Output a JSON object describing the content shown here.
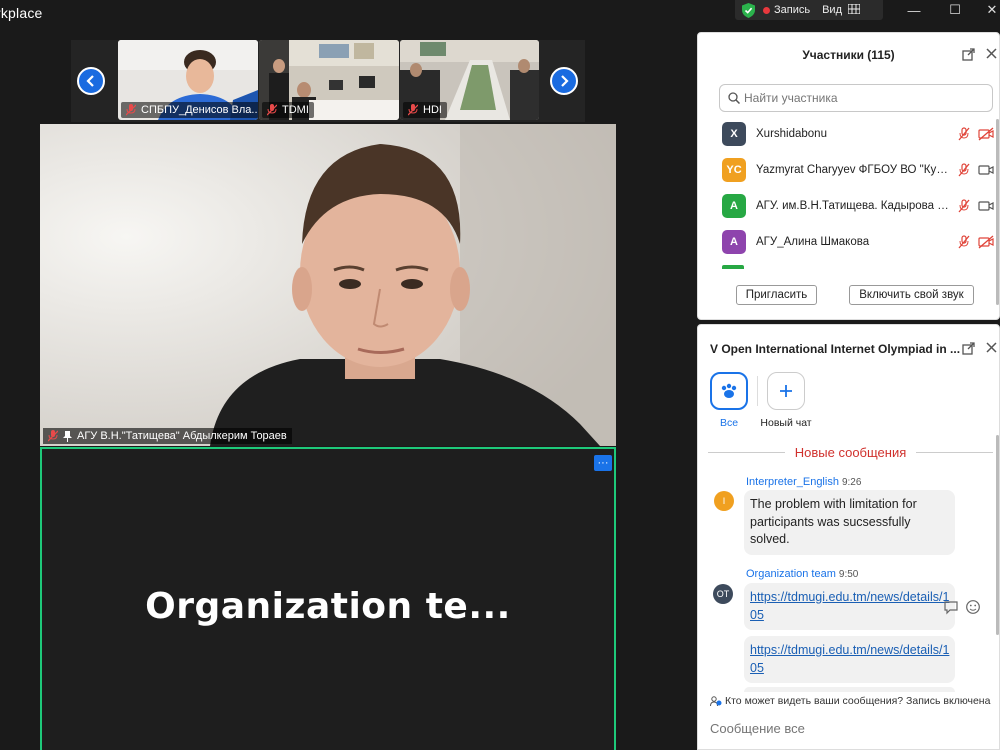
{
  "window": {
    "title": "rkplace",
    "recording_label": "Запись",
    "view_label": "Вид",
    "minimize": "—",
    "maximize": "☐",
    "close": "✕"
  },
  "filmstrip": {
    "tiles": [
      {
        "label": "СПБПУ_Денисов Вла..."
      },
      {
        "label": "TDMI"
      },
      {
        "label": "HDI"
      }
    ]
  },
  "main_video": {
    "label": "АГУ В.Н.\"Татищева\" Абдылкерим Тораев"
  },
  "active_tile": {
    "name": "Organization  te...",
    "menu": "···"
  },
  "participants": {
    "title": "Участники (115)",
    "search_placeholder": "Найти участника",
    "items": [
      {
        "initials": "X",
        "color": "#3d4a5c",
        "name": "Xurshidabonu",
        "video_muted": true
      },
      {
        "initials": "YC",
        "color": "#f0a020",
        "name": "Yazmyrat Charyyev ФГБОУ ВО \"КубГ...",
        "video_muted": false
      },
      {
        "initials": "A",
        "color": "#27a844",
        "name": "АГУ. им.В.Н.Татищева. Кадырова Л...",
        "video_muted": false
      },
      {
        "initials": "A",
        "color": "#8e44ad",
        "name": "АГУ_Алина Шмакова",
        "video_muted": true
      }
    ],
    "invite_label": "Пригласить",
    "unmute_label": "Включить свой звук"
  },
  "chat": {
    "title": "V Open International Internet Olympiad in ...",
    "tabs": [
      {
        "label": "Все",
        "active": true
      },
      {
        "label": "Новый чат",
        "active": false
      }
    ],
    "new_messages_divider": "Новые сообщения",
    "messages": [
      {
        "avatar": "I",
        "avatar_color": "#f0a020",
        "sender": "Interpreter_English",
        "time": "9:26",
        "text": "The problem with limitation for participants was sucsessfully solved."
      },
      {
        "avatar": "OT",
        "avatar_color": "#3d4a5c",
        "sender": "Organization team",
        "time": "9:50",
        "links": [
          "https://tdmugi.edu.tm/news/details/105",
          "https://tdmugi.edu.tm/news/details/105"
        ]
      }
    ],
    "privacy_text": "Кто может видеть ваши сообщения? Запись включена",
    "composer_placeholder": "Сообщение все"
  },
  "colors": {
    "accent_blue": "#1a73e8",
    "active_speaker_border": "#1ec97a",
    "recording_red": "#e8383d",
    "new_messages_red": "#d0312d"
  }
}
